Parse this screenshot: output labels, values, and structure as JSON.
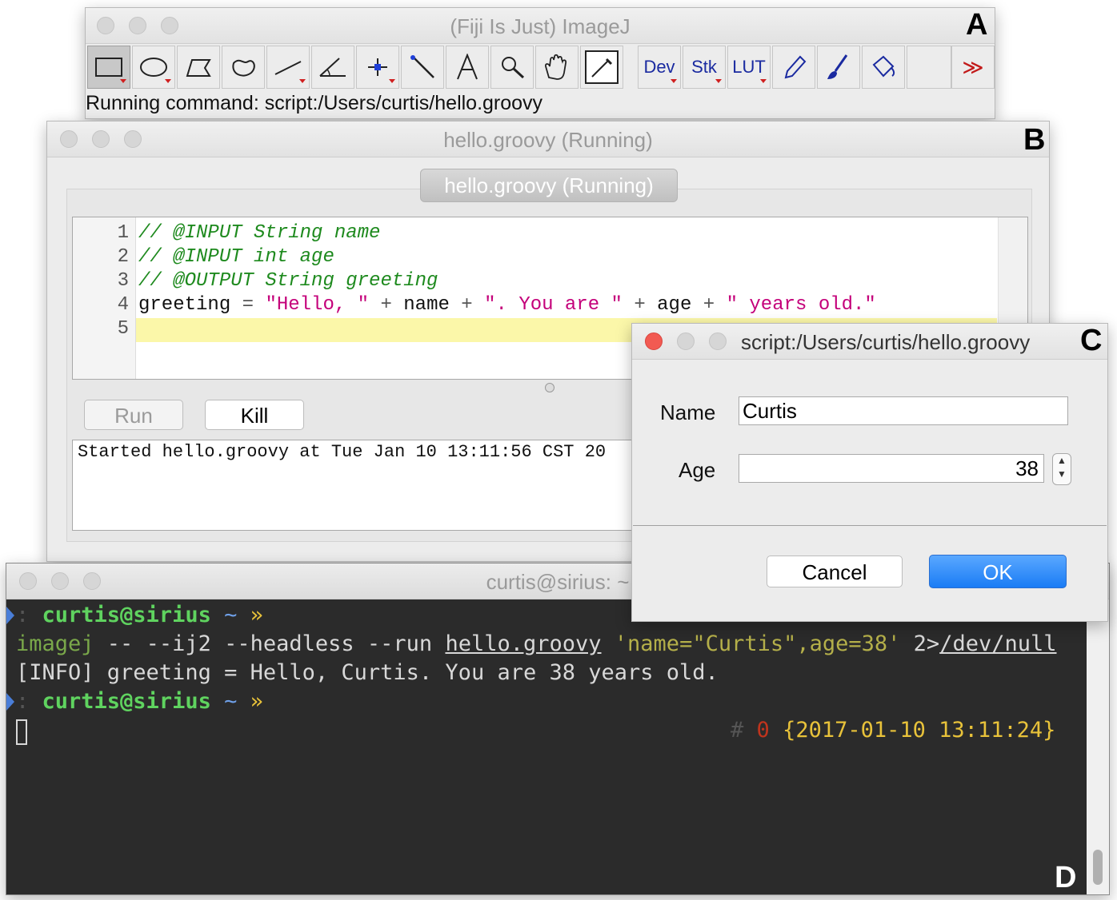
{
  "window_a": {
    "title": "(Fiji Is Just) ImageJ",
    "panel_letter": "A",
    "status": "Running command: script:/Users/curtis/hello.groovy",
    "tools": [
      "rectangle-icon",
      "oval-icon",
      "polygon-icon",
      "freehand-icon",
      "line-icon",
      "angle-icon",
      "point-icon",
      "wand-icon",
      "text-icon",
      "magnifier-icon",
      "hand-icon",
      "dropper-icon"
    ],
    "tool_dev": "Dev",
    "tool_stk": "Stk",
    "tool_lut": "LUT",
    "more": "≫"
  },
  "window_b": {
    "title": "hello.groovy (Running)",
    "panel_letter": "B",
    "tab_label": "hello.groovy (Running)",
    "line_numbers": [
      "1",
      "2",
      "3",
      "4",
      "5"
    ],
    "code": {
      "l1": "// @INPUT String name",
      "l2": "// @INPUT int age",
      "l3": "// @OUTPUT String greeting",
      "l4_a": "greeting ",
      "l4_b": "= ",
      "l4_c": "\"Hello, \"",
      "l4_d": " + ",
      "l4_e": "name",
      "l4_f": " + ",
      "l4_g": "\". You are \"",
      "l4_h": " + ",
      "l4_i": "age",
      "l4_j": " + ",
      "l4_k": "\" years old.\""
    },
    "run_label": "Run",
    "kill_label": "Kill",
    "output": "Started hello.groovy at Tue Jan 10 13:11:56 CST 20"
  },
  "window_c": {
    "title": "script:/Users/curtis/hello.groovy",
    "panel_letter": "C",
    "name_label": "Name",
    "name_value": "Curtis",
    "age_label": "Age",
    "age_value": "38",
    "cancel_label": "Cancel",
    "ok_label": "OK"
  },
  "window_d": {
    "title": "curtis@sirius: ~",
    "panel_letter": "D",
    "prompt_user": "curtis@sirius",
    "prompt_dir": " ~ ",
    "prompt_arrow": "»",
    "cmd_prog": "imagej",
    "cmd_args": " -- --ij2 --headless --run ",
    "cmd_file": "hello.groovy",
    "cmd_params": " 'name=\"Curtis\",age=38'",
    "cmd_redirect": " 2>",
    "cmd_devnull": "/dev/null",
    "info_line": "[INFO] greeting = Hello, Curtis. You are 38 years old.",
    "rp_hash": "#",
    "rp_status": "0",
    "rp_time": "{2017-01-10 13:11:24}"
  },
  "colors": {
    "comment": "#1e8a1e",
    "string": "#c4007a",
    "highlight": "#fbf7a9",
    "ok_button": "#1a7cf5",
    "term_bg": "#2b2b2b"
  }
}
